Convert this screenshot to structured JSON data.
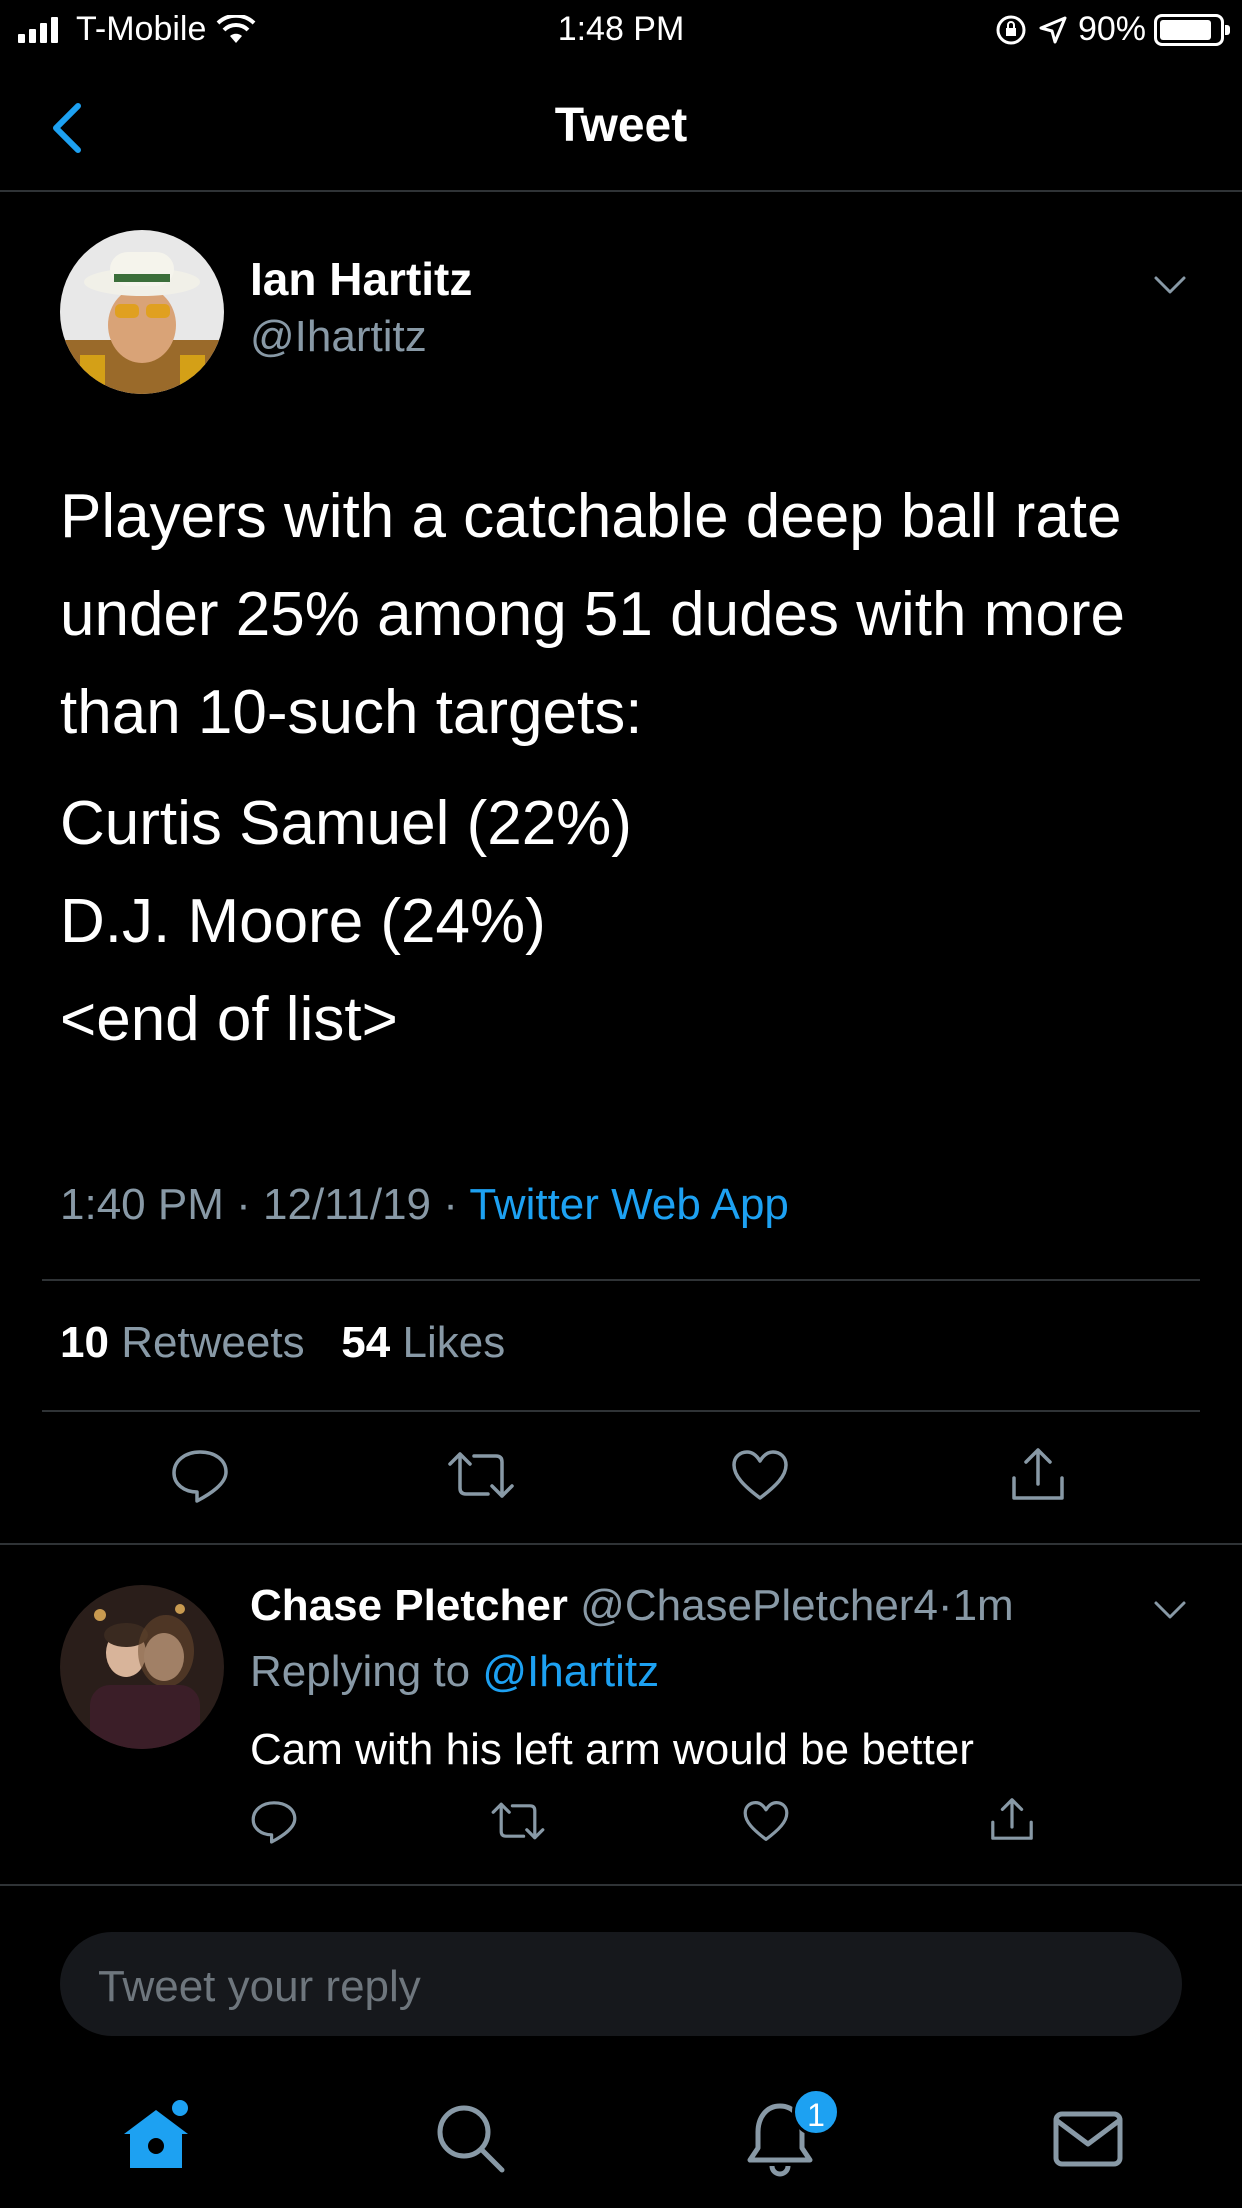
{
  "status_bar": {
    "carrier": "T-Mobile",
    "time": "1:48 PM",
    "battery": "90%",
    "battery_level": 0.9
  },
  "nav": {
    "title": "Tweet",
    "back_icon": "chevron-left-icon"
  },
  "tweet": {
    "author_name": "Ian Hartitz",
    "author_handle": "@Ihartitz",
    "text": "Players with a catchable deep ball rate under 25% among 51 dudes with more than 10-such targets:",
    "list": [
      "Curtis Samuel (22%)",
      "D.J. Moore (24%)",
      "<end of list>"
    ],
    "time": "1:40 PM",
    "date": "12/11/19",
    "separator": "·",
    "source": "Twitter Web App",
    "retweets_count": "10",
    "retweets_label": "Retweets",
    "likes_count": "54",
    "likes_label": "Likes"
  },
  "reply": {
    "author_name": "Chase Pletcher",
    "author_handle": "@ChasePletcher4",
    "dot": "·",
    "age": "1m",
    "replying_label": "Replying to",
    "replying_mention": "@Ihartitz",
    "text": "Cam with his left arm would be better"
  },
  "composer": {
    "placeholder": "Tweet your reply"
  },
  "tabbar": {
    "notifications_badge": "1"
  },
  "colors": {
    "accent": "#1da1f2",
    "background": "#000000",
    "muted": "#8899a6",
    "divider": "#2f3336"
  }
}
